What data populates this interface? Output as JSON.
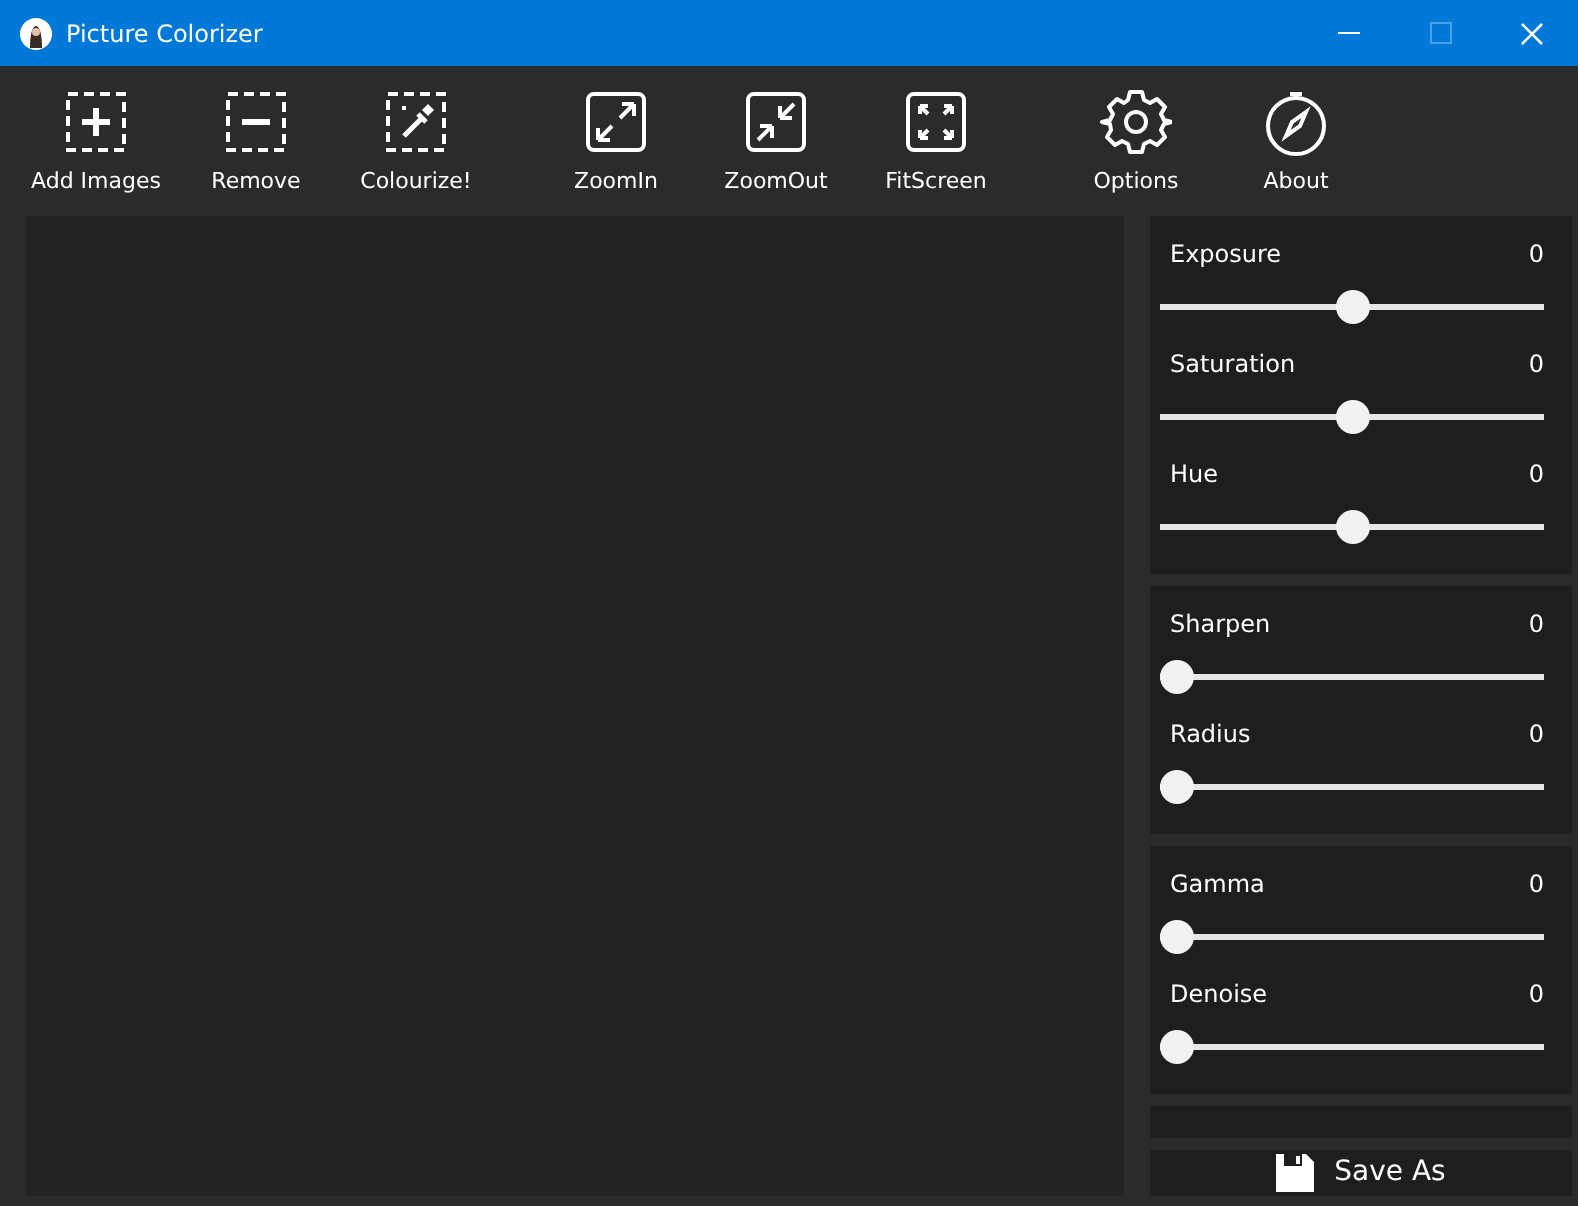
{
  "window": {
    "title": "Picture Colorizer"
  },
  "toolbar_groups": [
    {
      "buttons": [
        {
          "label": "Add Images",
          "kind": "add"
        },
        {
          "label": "Remove",
          "kind": "remove"
        },
        {
          "label": "Colourize!",
          "kind": "colourize"
        }
      ]
    },
    {
      "buttons": [
        {
          "label": "ZoomIn",
          "kind": "zoomin"
        },
        {
          "label": "ZoomOut",
          "kind": "zoomout"
        },
        {
          "label": "FitScreen",
          "kind": "fit"
        }
      ]
    },
    {
      "buttons": [
        {
          "label": "Options",
          "kind": "options"
        },
        {
          "label": "About",
          "kind": "about"
        }
      ]
    }
  ],
  "adjustment_groups": [
    {
      "sliders": [
        {
          "label": "Exposure",
          "value": "0",
          "level": 0.5
        },
        {
          "label": "Saturation",
          "value": "0",
          "level": 0.5
        },
        {
          "label": "Hue",
          "value": "0",
          "level": 0.5
        }
      ]
    },
    {
      "sliders": [
        {
          "label": "Sharpen",
          "value": "0",
          "level": 0
        },
        {
          "label": "Radius",
          "value": "0",
          "level": 0
        }
      ]
    },
    {
      "sliders": [
        {
          "label": "Gamma",
          "value": "0",
          "level": 0
        },
        {
          "label": "Denoise",
          "value": "0",
          "level": 0
        }
      ]
    }
  ],
  "save_button": {
    "label": "Save As"
  }
}
